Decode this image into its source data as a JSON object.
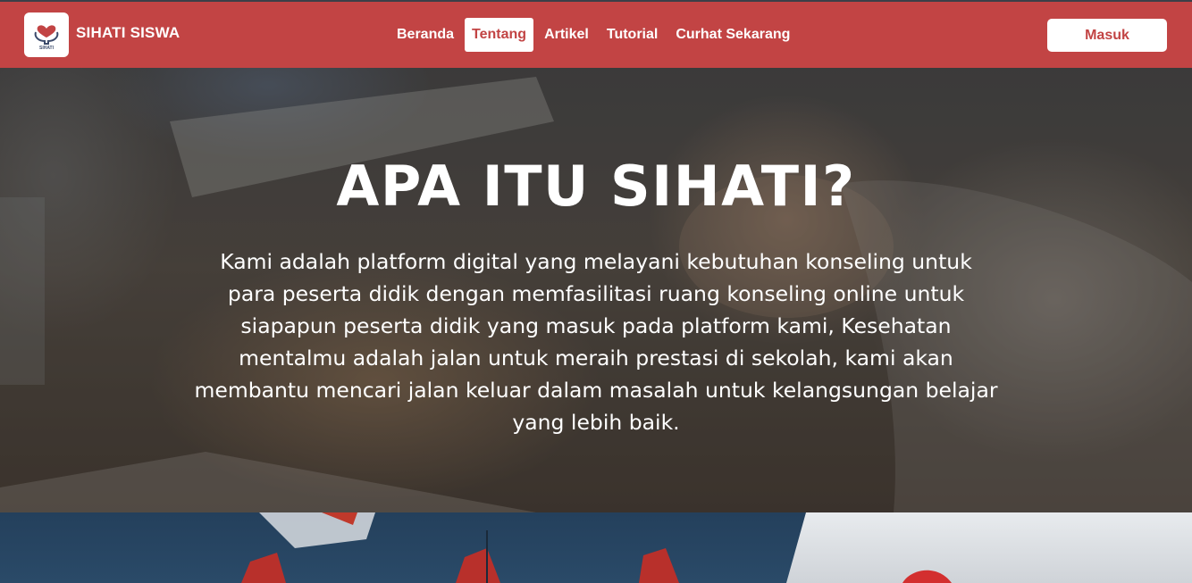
{
  "navbar": {
    "logo_icon": "heart-hands-logo-icon",
    "logo_text": "SIHATI",
    "brand": "SIHATI SISWA",
    "items": [
      {
        "label": "Beranda",
        "active": false
      },
      {
        "label": "Tentang",
        "active": true
      },
      {
        "label": "Artikel",
        "active": false
      },
      {
        "label": "Tutorial",
        "active": false
      },
      {
        "label": "Curhat Sekarang",
        "active": false
      }
    ],
    "login_label": "Masuk"
  },
  "hero": {
    "title": "APA ITU SIHATI?",
    "text": "Kami adalah platform digital yang melayani kebutuhan konseling untuk para peserta didik dengan memfasilitasi ruang konseling online untuk siapapun peserta didik yang masuk pada platform kami, Kesehatan mentalmu adalah jalan untuk meraih prestasi di sekolah, kami akan membantu mencari jalan keluar dalam masalah untuk kelangsungan belajar yang lebih baik."
  },
  "colors": {
    "accent": "#c24444",
    "white": "#ffffff"
  }
}
